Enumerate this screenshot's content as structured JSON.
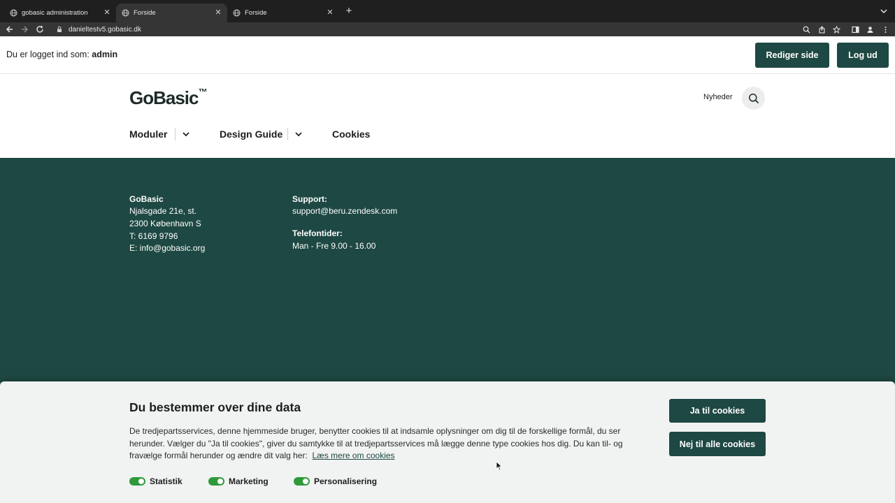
{
  "browser": {
    "tabs": [
      {
        "title": "gobasic administration",
        "active": false
      },
      {
        "title": "Forside",
        "active": true
      },
      {
        "title": "Forside",
        "active": false
      }
    ],
    "url": "danieltestv5.gobasic.dk"
  },
  "admin_bar": {
    "logged_in_prefix": "Du er logget ind som:",
    "username": "admin",
    "edit_button": "Rediger side",
    "logout_button": "Log ud"
  },
  "header": {
    "logo_text": "GoBasic",
    "logo_tm": "™",
    "news_link": "Nyheder",
    "menu": [
      {
        "label": "Moduler",
        "has_dropdown": true
      },
      {
        "label": "Design Guide",
        "has_dropdown": true
      },
      {
        "label": "Cookies",
        "has_dropdown": false
      }
    ]
  },
  "footer": {
    "company": {
      "name": "GoBasic",
      "street": "Njalsgade 21e, st.",
      "city": "2300 København S",
      "phone": "T: 6169 9796",
      "email": "E: info@gobasic.org"
    },
    "support": {
      "heading": "Support:",
      "email": "support@beru.zendesk.com",
      "hours_heading": "Telefontider:",
      "hours": "Man - Fre 9.00 - 16.00"
    }
  },
  "cookie_banner": {
    "title": "Du bestemmer over dine data",
    "text_1": "De tredjepartsservices, denne hjemmeside bruger, benytter cookies til at indsamle oplysninger om dig til de forskellige formål, du ser",
    "text_2": "herunder. Vælger du \"Ja til cookies\", giver du samtykke til at tredjepartsservices må lægge denne type cookies hos dig. Du kan til- og",
    "text_3": "fravælge formål herunder og ændre dit valg her:",
    "link": "Læs mere om cookies",
    "accept_button": "Ja til cookies",
    "reject_button": "Nej til alle cookies",
    "toggles": [
      {
        "label": "Statistik",
        "on": true
      },
      {
        "label": "Marketing",
        "on": true
      },
      {
        "label": "Personalisering",
        "on": true
      }
    ]
  },
  "colors": {
    "brand_dark_green": "#1e4843",
    "toggle_green": "#2e9a3a",
    "banner_bg": "#f1f3f2"
  }
}
